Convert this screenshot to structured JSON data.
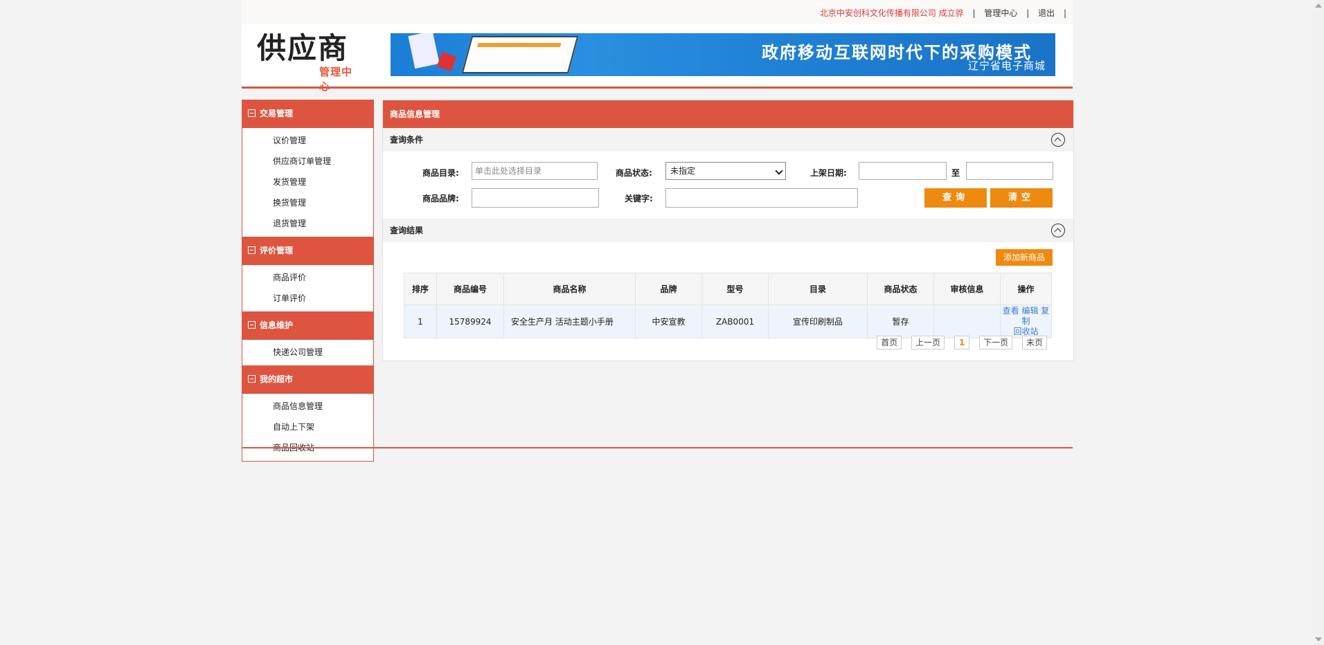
{
  "topbar": {
    "company": "北京中安创科文化传播有限公司 成立骅",
    "sep": "|",
    "admin_center": "管理中心",
    "logout": "退出"
  },
  "header": {
    "logo_big": "供应商",
    "logo_small": "管理中心",
    "banner_title": "政府移动互联网时代下的采购模式",
    "banner_subtitle": "辽宁省电子商城"
  },
  "sidebar": {
    "groups": [
      {
        "title": "交易管理",
        "items": [
          "议价管理",
          "供应商订单管理",
          "发货管理",
          "换货管理",
          "退货管理"
        ]
      },
      {
        "title": "评价管理",
        "items": [
          "商品评价",
          "订单评价"
        ]
      },
      {
        "title": "信息维护",
        "items": [
          "快递公司管理"
        ]
      },
      {
        "title": "我的超市",
        "items": [
          "商品信息管理",
          "自动上下架",
          "商品回收站"
        ]
      }
    ]
  },
  "main": {
    "title": "商品信息管理",
    "query": {
      "section_title": "查询条件",
      "catalog_label": "商品目录:",
      "catalog_placeholder": "单击此处选择目录",
      "status_label": "商品状态:",
      "status_value": "未指定",
      "date_label": "上架日期:",
      "date_to": "至",
      "brand_label": "商品品牌:",
      "keyword_label": "关键字:",
      "search_btn": "查询",
      "clear_btn": "清空"
    },
    "results": {
      "section_title": "查询结果",
      "add_btn": "添加新商品",
      "columns": [
        "排序",
        "商品编号",
        "商品名称",
        "品牌",
        "型号",
        "目录",
        "商品状态",
        "审核信息",
        "操作"
      ],
      "rows": [
        {
          "order": "1",
          "code": "15789924",
          "name": "安全生产月 活动主题小手册",
          "brand": "中安宣教",
          "model": "ZAB0001",
          "catalog": "宣传印刷制品",
          "status": "暂存",
          "audit": "",
          "ops_line1": "查看 编辑 复制",
          "ops_line2": "回收站"
        }
      ]
    },
    "pager": {
      "first": "首页",
      "prev": "上一页",
      "current": "1",
      "next": "下一页",
      "last": "末页"
    }
  }
}
